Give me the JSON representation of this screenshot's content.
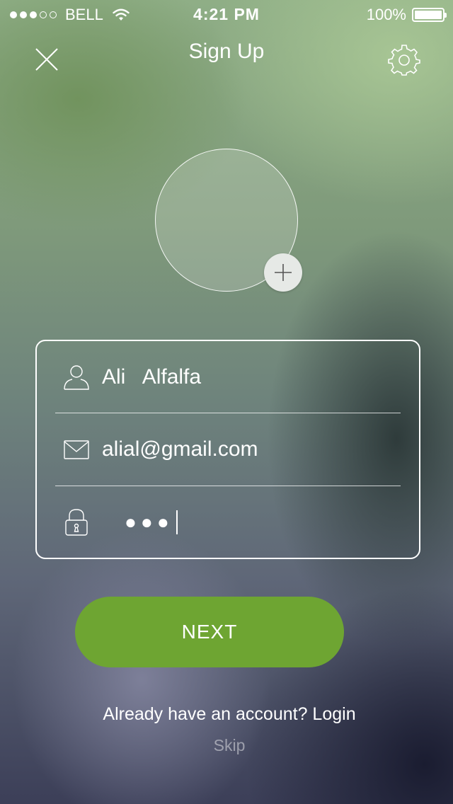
{
  "status_bar": {
    "carrier": "BELL",
    "time": "4:21 PM",
    "battery": "100%",
    "signal_bars_filled": 3,
    "signal_bars_total": 5
  },
  "header": {
    "title": "Sign Up",
    "close_icon": "close-icon",
    "settings_icon": "gear-icon"
  },
  "avatar": {
    "add_icon": "plus-icon"
  },
  "form": {
    "name": {
      "icon": "user-icon",
      "value": "Ali   Alfalfa"
    },
    "email": {
      "icon": "envelope-icon",
      "value": "alial@gmail.com"
    },
    "password": {
      "icon": "lock-icon",
      "value": "●●●"
    }
  },
  "actions": {
    "next_label": "NEXT",
    "login_prompt": "Already have an account? Login",
    "skip_label": "Skip"
  },
  "colors": {
    "accent_button": "#6ea532",
    "text": "#ffffff"
  }
}
